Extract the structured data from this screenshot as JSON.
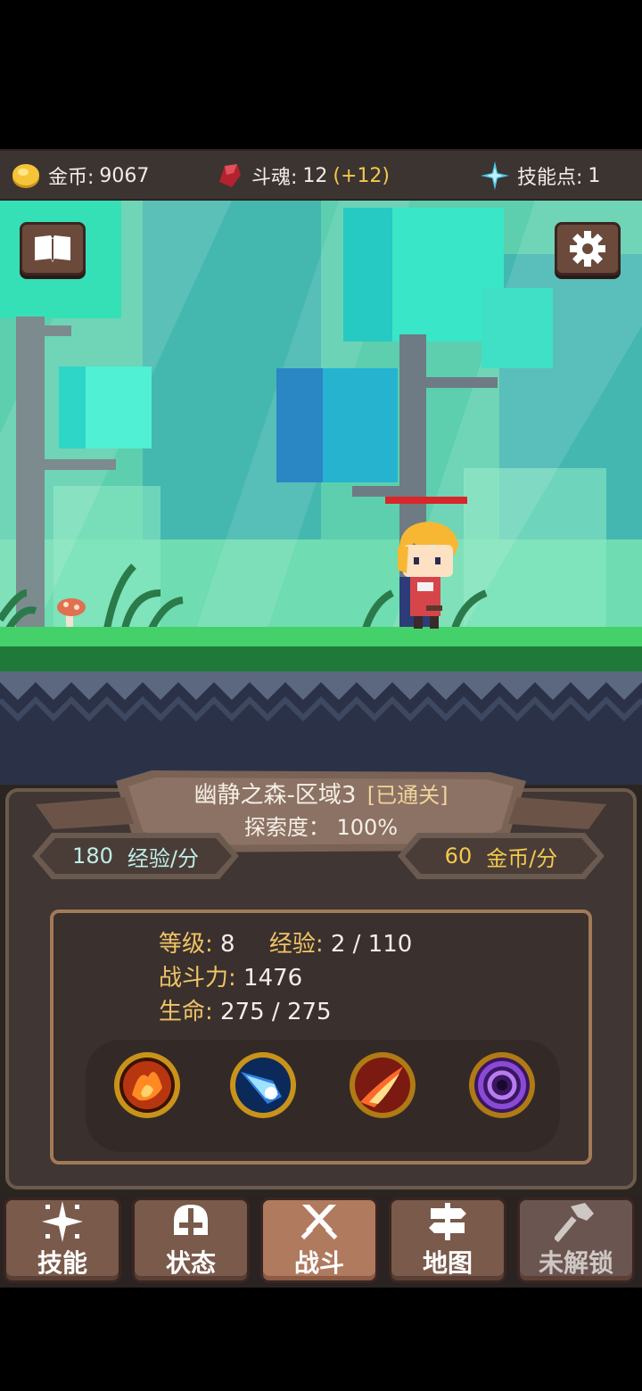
{
  "resources": {
    "gold": {
      "label": "金币:",
      "value": "9067"
    },
    "soul": {
      "label": "斗魂:",
      "value": "12",
      "bonus": "(+12)"
    },
    "skill_points": {
      "label": "技能点:",
      "value": "1"
    }
  },
  "scene": {
    "buttons": [
      "book-button",
      "settings-button"
    ]
  },
  "zone": {
    "name": "幽静之森-区域3",
    "cleared": "[已通关]",
    "exploration_label": "探索度：",
    "exploration_value": "100%"
  },
  "rates": {
    "exp": {
      "value": "180",
      "label": "经验/分"
    },
    "gold": {
      "value": "60",
      "label": "金币/分"
    }
  },
  "stats": {
    "level_label": "等级:",
    "level_value": "8",
    "exp_label": "经验:",
    "exp_value": "2 / 110",
    "power_label": "战斗力:",
    "power_value": "1476",
    "hp_label": "生命:",
    "hp_value": "275 / 275"
  },
  "skills": [
    "fire-skill-icon",
    "ice-dash-skill-icon",
    "flame-slash-skill-icon",
    "void-vortex-skill-icon"
  ],
  "nav": [
    {
      "label": "技能",
      "icon": "sparkle-icon"
    },
    {
      "label": "状态",
      "icon": "helmet-icon"
    },
    {
      "label": "战斗",
      "icon": "crossed-swords-icon"
    },
    {
      "label": "地图",
      "icon": "signpost-icon"
    },
    {
      "label": "未解锁",
      "icon": "hammer-icon"
    }
  ],
  "colors": {
    "accent_gold": "#f2c94c",
    "label_gold": "#f0c468",
    "grass": "#45d16a",
    "hp_bar": "#d8262a"
  }
}
